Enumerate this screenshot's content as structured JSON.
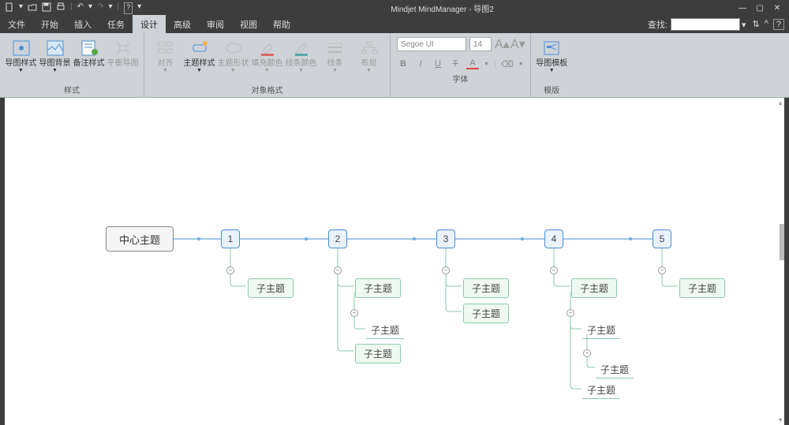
{
  "app": {
    "title": "Mindjet MindManager - 导图2"
  },
  "menu": {
    "items": [
      "文件",
      "开始",
      "插入",
      "任务",
      "设计",
      "高级",
      "审阅",
      "视图",
      "帮助"
    ],
    "active_index": 4,
    "search_label": "查找:"
  },
  "ribbon": {
    "groups": {
      "style": {
        "label": "样式",
        "btns": [
          {
            "label": "导图样式",
            "drop": true
          },
          {
            "label": "导图背景",
            "drop": true
          },
          {
            "label": "备注样式"
          },
          {
            "label": "平衡导图",
            "disabled": true
          }
        ]
      },
      "object": {
        "label": "对象格式",
        "btns": [
          {
            "label": "对齐",
            "drop": true,
            "disabled": true
          },
          {
            "label": "主题样式",
            "drop": true
          },
          {
            "label": "主题形状",
            "drop": true,
            "disabled": true
          },
          {
            "label": "填充颜色",
            "drop": true,
            "disabled": true
          },
          {
            "label": "线条颜色",
            "drop": true,
            "disabled": true
          },
          {
            "label": "线条",
            "drop": true,
            "disabled": true
          },
          {
            "label": "布局",
            "drop": true,
            "disabled": true
          }
        ]
      },
      "font": {
        "label": "字体",
        "name": "Segoe UI",
        "size": "14",
        "btns": [
          "B",
          "I",
          "U",
          "T",
          "A"
        ]
      },
      "template": {
        "label": "模版",
        "btns": [
          {
            "label": "导图模板",
            "drop": true
          }
        ]
      }
    }
  },
  "map": {
    "center": "中心主题",
    "mains": [
      "1",
      "2",
      "3",
      "4",
      "5"
    ],
    "sub_label": "子主题"
  }
}
